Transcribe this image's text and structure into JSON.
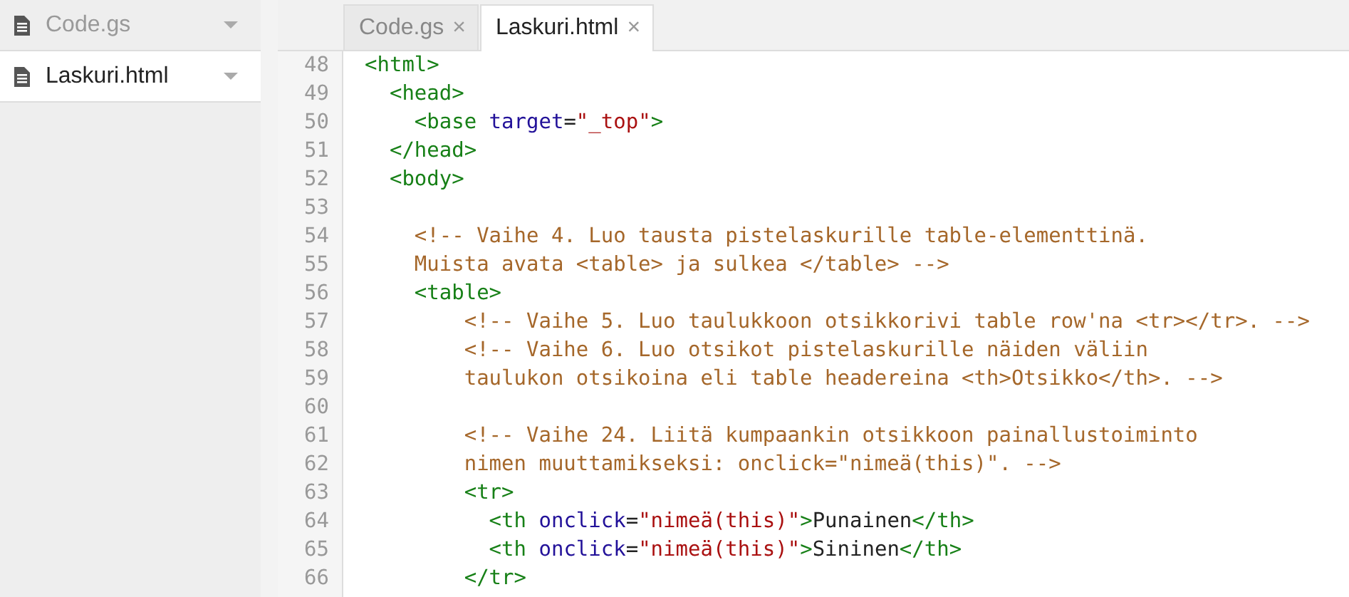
{
  "sidebar": {
    "files": [
      {
        "name": "Code.gs",
        "selected": false
      },
      {
        "name": "Laskuri.html",
        "selected": true
      }
    ]
  },
  "tabs": [
    {
      "label": "Code.gs",
      "selected": false,
      "close": "×"
    },
    {
      "label": "Laskuri.html",
      "selected": true,
      "close": "×"
    }
  ],
  "editor": {
    "lines": [
      {
        "number": "48",
        "tokens": [
          {
            "kind": "tag",
            "text": "<html>"
          }
        ]
      },
      {
        "number": "49",
        "tokens": [
          {
            "kind": "tag",
            "text": "  <head>"
          }
        ]
      },
      {
        "number": "50",
        "tokens": [
          {
            "kind": "tag",
            "text": "    <base"
          },
          {
            "kind": "attr",
            "text": " target"
          },
          {
            "kind": "text",
            "text": "="
          },
          {
            "kind": "string",
            "text": "\"_top\""
          },
          {
            "kind": "tag",
            "text": ">"
          }
        ]
      },
      {
        "number": "51",
        "tokens": [
          {
            "kind": "tag",
            "text": "  </head>"
          }
        ]
      },
      {
        "number": "52",
        "tokens": [
          {
            "kind": "tag",
            "text": "  <body>"
          }
        ]
      },
      {
        "number": "53"
      },
      {
        "number": "54",
        "tokens": [
          {
            "kind": "comment",
            "text": "    <!-- Vaihe 4. Luo tausta pistelaskurille table-elementtinä."
          }
        ]
      },
      {
        "number": "55",
        "tokens": [
          {
            "kind": "comment",
            "text": "    Muista avata <table> ja sulkea </table> -->"
          }
        ]
      },
      {
        "number": "56",
        "tokens": [
          {
            "kind": "tag",
            "text": "    <table>"
          }
        ]
      },
      {
        "number": "57",
        "tokens": [
          {
            "kind": "comment",
            "text": "        <!-- Vaihe 5. Luo taulukkoon otsikkorivi table row'na <tr></tr>. -->"
          }
        ]
      },
      {
        "number": "58",
        "tokens": [
          {
            "kind": "comment",
            "text": "        <!-- Vaihe 6. Luo otsikot pistelaskurille näiden väliin"
          }
        ]
      },
      {
        "number": "59",
        "tokens": [
          {
            "kind": "comment",
            "text": "        taulukon otsikoina eli table headereina <th>Otsikko</th>. -->"
          }
        ]
      },
      {
        "number": "60"
      },
      {
        "number": "61",
        "tokens": [
          {
            "kind": "comment",
            "text": "        <!-- Vaihe 24. Liitä kumpaankin otsikkoon painallustoiminto"
          }
        ]
      },
      {
        "number": "62",
        "tokens": [
          {
            "kind": "comment",
            "text": "        nimen muuttamikseksi: onclick=\"nimeä(this)\". -->"
          }
        ]
      },
      {
        "number": "63",
        "tokens": [
          {
            "kind": "tag",
            "text": "        <tr>"
          }
        ]
      },
      {
        "number": "64",
        "tokens": [
          {
            "kind": "tag",
            "text": "          <th"
          },
          {
            "kind": "attr",
            "text": " onclick"
          },
          {
            "kind": "text",
            "text": "="
          },
          {
            "kind": "string",
            "text": "\"nimeä(this)\""
          },
          {
            "kind": "tag",
            "text": ">"
          },
          {
            "kind": "text",
            "text": "Punainen"
          },
          {
            "kind": "tag",
            "text": "</th>"
          }
        ]
      },
      {
        "number": "65",
        "tokens": [
          {
            "kind": "tag",
            "text": "          <th"
          },
          {
            "kind": "attr",
            "text": " onclick"
          },
          {
            "kind": "text",
            "text": "="
          },
          {
            "kind": "string",
            "text": "\"nimeä(this)\""
          },
          {
            "kind": "tag",
            "text": ">"
          },
          {
            "kind": "text",
            "text": "Sininen"
          },
          {
            "kind": "tag",
            "text": "</th>"
          }
        ]
      },
      {
        "number": "66",
        "tokens": [
          {
            "kind": "tag",
            "text": "        </tr>"
          }
        ]
      }
    ]
  }
}
